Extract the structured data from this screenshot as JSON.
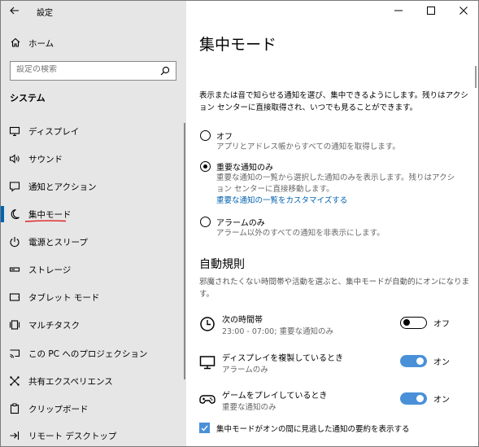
{
  "app": {
    "title": "設定"
  },
  "sidebar": {
    "home_label": "ホーム",
    "search_placeholder": "設定の検索",
    "section_title": "システム",
    "items": [
      {
        "label": "ディスプレイ",
        "icon": "monitor-icon"
      },
      {
        "label": "サウンド",
        "icon": "speaker-icon"
      },
      {
        "label": "通知とアクション",
        "icon": "notification-icon"
      },
      {
        "label": "集中モード",
        "icon": "moon-icon",
        "active": true
      },
      {
        "label": "電源とスリープ",
        "icon": "power-icon"
      },
      {
        "label": "ストレージ",
        "icon": "storage-icon"
      },
      {
        "label": "タブレット モード",
        "icon": "tablet-icon"
      },
      {
        "label": "マルチタスク",
        "icon": "multitask-icon"
      },
      {
        "label": "この PC へのプロジェクション",
        "icon": "projection-icon"
      },
      {
        "label": "共有エクスペリエンス",
        "icon": "shared-icon"
      },
      {
        "label": "クリップボード",
        "icon": "clipboard-icon"
      },
      {
        "label": "リモート デスクトップ",
        "icon": "remote-desktop-icon"
      }
    ]
  },
  "main": {
    "title": "集中モード",
    "description": "表示または音で知らせる通知を選び、集中できるようにします。残りはアクション センターに直接取得され、いつでも見ることができます。",
    "options": [
      {
        "label": "オフ",
        "desc": "アプリとアドレス帳からすべての通知を取得します。",
        "selected": false
      },
      {
        "label": "重要な通知のみ",
        "desc": "重要な通知の一覧から選択した通知のみを表示します。残りはアクション センターに直接移動します。",
        "link": "重要な通知の一覧をカスタマイズする",
        "selected": true
      },
      {
        "label": "アラームのみ",
        "desc": "アラーム以外のすべての通知を非表示にします。",
        "selected": false
      }
    ],
    "auto_rules_title": "自動規則",
    "auto_rules_desc": "邪魔されたくない時間帯や活動を選ぶと、集中モードが自動的にオンになります。",
    "rules": [
      {
        "title": "次の時間帯",
        "sub": "23:00 - 07:00; 重要な通知のみ",
        "state": "オフ",
        "on": false,
        "icon": "clock-icon"
      },
      {
        "title": "ディスプレイを複製しているとき",
        "sub": "アラームのみ",
        "state": "オン",
        "on": true,
        "icon": "monitor-icon"
      },
      {
        "title": "ゲームをプレイしているとき",
        "sub": "重要な通知のみ",
        "state": "オン",
        "on": true,
        "icon": "gamepad-icon"
      }
    ],
    "summary_checkbox": "集中モードがオンの間に見逃した通知の要約を表示する"
  },
  "colors": {
    "accent": "#0063b1",
    "toggle_on": "#4a90d9",
    "sidebar_bg": "#e6e6e6",
    "underline": "#e02020"
  }
}
